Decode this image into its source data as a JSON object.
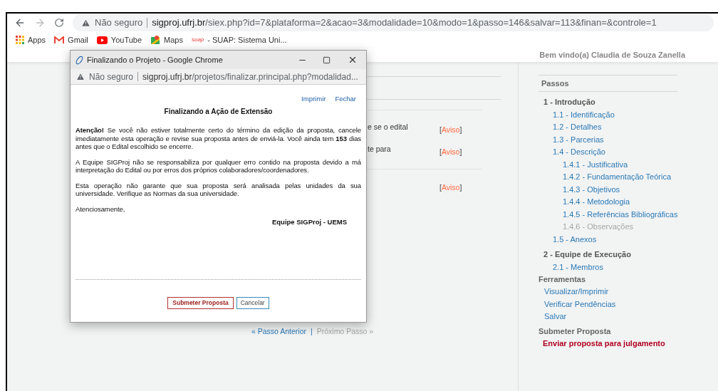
{
  "browser": {
    "address_warning": "Não seguro",
    "url_host": "sigproj.ufrj.br",
    "url_path": "/siex.php?id=7&plataforma=2&acao=3&modalidade=10&modo=1&passo=146&salvar=113&finan=&controle=1"
  },
  "bookmarks": [
    {
      "label": "Apps",
      "kind": "apps"
    },
    {
      "label": "Gmail",
      "kind": "gmail"
    },
    {
      "label": "YouTube",
      "kind": "youtube"
    },
    {
      "label": "Maps",
      "kind": "maps"
    },
    {
      "label": "- SUAP: Sistema Uni...",
      "kind": "suap",
      "badge": "suap"
    }
  ],
  "header": {
    "welcome": "Bem vindo(a) Claudia de Souza Zanella"
  },
  "main": {
    "bracket_open": "[",
    "bracket_close": "]",
    "rows": [
      {
        "text": "e se o edital",
        "link": "Aviso"
      },
      {
        "text": "te para",
        "link": "Aviso"
      },
      {
        "text": "",
        "link": "Aviso"
      }
    ],
    "nav": [
      {
        "label": "« Passo Anterior",
        "disabled": false
      },
      {
        "label": "Próximo Passo »",
        "disabled": true
      }
    ],
    "nav_separator": "|"
  },
  "sidebar": {
    "title": "Passos",
    "steps": [
      {
        "label": "1 - Introdução",
        "disabled": false,
        "children": [
          {
            "label": "1.1 - Identificação",
            "disabled": false
          },
          {
            "label": "1.2 - Detalhes",
            "disabled": false
          },
          {
            "label": "1.3 - Parcerias",
            "disabled": false
          },
          {
            "label": "1.4 - Descrição",
            "disabled": false,
            "children": [
              {
                "label": "1.4.1 - Justificativa",
                "disabled": false
              },
              {
                "label": "1.4.2 - Fundamentação Teórica",
                "disabled": false
              },
              {
                "label": "1.4.3 - Objetivos",
                "disabled": false
              },
              {
                "label": "1.4.4 - Metodologia",
                "disabled": false
              },
              {
                "label": "1.4.5 - Referências Bibliográficas",
                "disabled": false
              },
              {
                "label": "1.4.6 - Observações",
                "disabled": true
              }
            ]
          },
          {
            "label": "1.5 - Anexos",
            "disabled": false
          }
        ]
      },
      {
        "label": "2 - Equipe de Execução",
        "disabled": false,
        "children": [
          {
            "label": "2.1 - Membros",
            "disabled": false
          }
        ]
      }
    ],
    "tools_title": "Ferramentas",
    "tools": [
      "Visualizar/Imprimir",
      "Verificar Pendências",
      "Salvar"
    ],
    "submit_title": "Submeter Proposta",
    "submit_link": "Enviar proposta para julgamento"
  },
  "dialog": {
    "title": "Finalizando o Projeto - Google Chrome",
    "address_warning": "Não seguro",
    "url_host": "sigproj.ufrj.br",
    "url_path": "/projetos/finalizar.principal.php?modalidad...",
    "links": [
      "Imprimir",
      "Fechar"
    ],
    "heading": "Finalizando a Ação de Extensão",
    "paragraphs": [
      "**Atenção!** Se você não estiver totalmente certo do término da edição da proposta, cancele imediatamente esta operação e revise sua proposta antes de enviá-la. Você ainda tem **153** dias antes que o Edital escolhido se encerre.",
      "A Equipe SIGProj não se responsabiliza por qualquer erro contido na proposta devido a má interpretação do Edital ou por erros dos próprios colaboradores/coordenadores.",
      "Esta operação não garante que sua proposta será analisada pelas unidades da sua universidade. Verifique as Normas da sua universidade.",
      "Atenciosamente,"
    ],
    "signature": "Equipe SIGProj - UEMS",
    "buttons": [
      {
        "label": "Submeter Proposta",
        "kind": "primary"
      },
      {
        "label": "Cancelar",
        "kind": "secondary"
      }
    ]
  }
}
